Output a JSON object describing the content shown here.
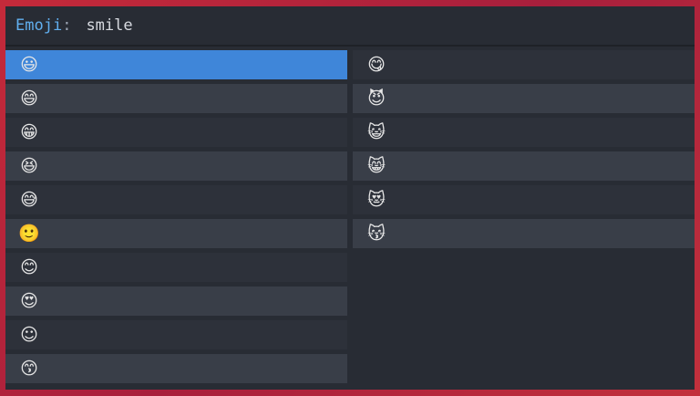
{
  "prompt": {
    "label": "Emoji",
    "separator": ":",
    "query": "smile"
  },
  "colors": {
    "selected": "#3f86d9",
    "row_dark": "#2d313a",
    "row_light": "#393e48",
    "label": "#61afef"
  },
  "results": {
    "left": [
      {
        "emoji": "😃",
        "selected": true
      },
      {
        "emoji": "😄",
        "selected": false
      },
      {
        "emoji": "😁",
        "selected": false
      },
      {
        "emoji": "😆",
        "selected": false
      },
      {
        "emoji": "😅",
        "selected": false
      },
      {
        "emoji": "🙂",
        "selected": false
      },
      {
        "emoji": "😊",
        "selected": false
      },
      {
        "emoji": "😍",
        "selected": false
      },
      {
        "emoji": "☺",
        "selected": false
      },
      {
        "emoji": "😙",
        "selected": false
      }
    ],
    "right": [
      {
        "emoji": "😋",
        "selected": false
      },
      {
        "emoji": "😈",
        "selected": false
      },
      {
        "emoji": "😺",
        "selected": false
      },
      {
        "emoji": "😸",
        "selected": false
      },
      {
        "emoji": "😻",
        "selected": false
      },
      {
        "emoji": "😽",
        "selected": false
      }
    ]
  }
}
